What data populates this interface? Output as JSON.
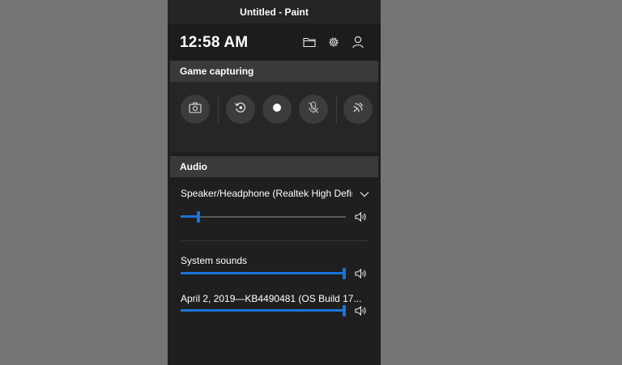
{
  "window": {
    "title": "Untitled - Paint"
  },
  "header": {
    "time": "12:58 AM",
    "icons": [
      "folder-icon",
      "gear-icon",
      "person-icon"
    ]
  },
  "capture": {
    "heading": "Game capturing",
    "buttons": [
      "camera-icon",
      "record-last-icon",
      "record-icon",
      "mic-off-icon",
      "broadcast-icon"
    ]
  },
  "audio": {
    "heading": "Audio",
    "device": {
      "name": "Speaker/Headphone (Realtek High Defin",
      "volume": 0.1
    },
    "apps": [
      {
        "label": "System sounds",
        "volume": 1.0
      },
      {
        "label": "April 2, 2019—KB4490481 (OS Build 17...",
        "volume": 1.0
      }
    ]
  },
  "colors": {
    "background": "#757575",
    "panel": "#1f1f1f",
    "section_header": "#3a3a3a",
    "accent": "#1a73d9"
  }
}
